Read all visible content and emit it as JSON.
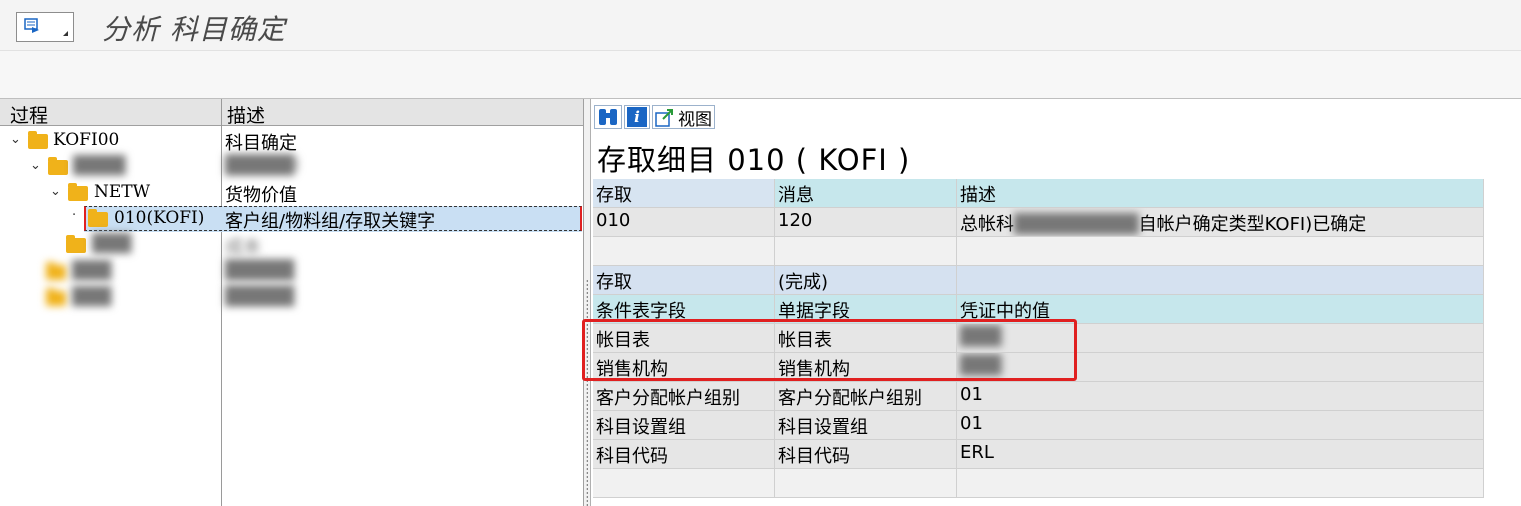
{
  "app": {
    "title": "分析 科目确定"
  },
  "icons": {
    "menu": "menu-icon",
    "find": "binoculars-icon",
    "info": "info-icon",
    "view": "view-icon"
  },
  "tree": {
    "headers": {
      "process": "过程",
      "description": "描述"
    },
    "rows": [
      {
        "label": "KOFI00",
        "desc": "科目确定"
      },
      {
        "label": "████",
        "desc": "█████l"
      },
      {
        "label": "NETW",
        "desc": "货物价值"
      },
      {
        "label": "010(KOFI)",
        "desc": "客户组/物料组/存取关键字"
      },
      {
        "label": "███",
        "desc": "成本"
      },
      {
        "label": "███",
        "desc": "█████"
      },
      {
        "label": "███",
        "desc": "█████"
      }
    ]
  },
  "detail": {
    "view_label": "视图",
    "title": "存取细目 010 ( KOFI )",
    "header": {
      "access": "存取",
      "message": "消息",
      "description": "描述"
    },
    "first": {
      "access": "010",
      "message": "120",
      "desc_prefix": "总帐科",
      "desc_blur": "█████████",
      "desc_suffix": "自帐户确定类型KOFI)已确定"
    },
    "status": {
      "access": "存取",
      "message": "(完成)"
    },
    "field_header": {
      "cond": "条件表字段",
      "doc": "单据字段",
      "value": "凭证中的值"
    },
    "rows": [
      {
        "cond": "帐目表",
        "doc": "帐目表",
        "value": "███"
      },
      {
        "cond": "销售机构",
        "doc": "销售机构",
        "value": "███"
      },
      {
        "cond": "客户分配帐户组别",
        "doc": "客户分配帐户组别",
        "value": "01"
      },
      {
        "cond": "科目设置组",
        "doc": "科目设置组",
        "value": "01"
      },
      {
        "cond": "科目代码",
        "doc": "科目代码",
        "value": "ERL"
      }
    ]
  }
}
